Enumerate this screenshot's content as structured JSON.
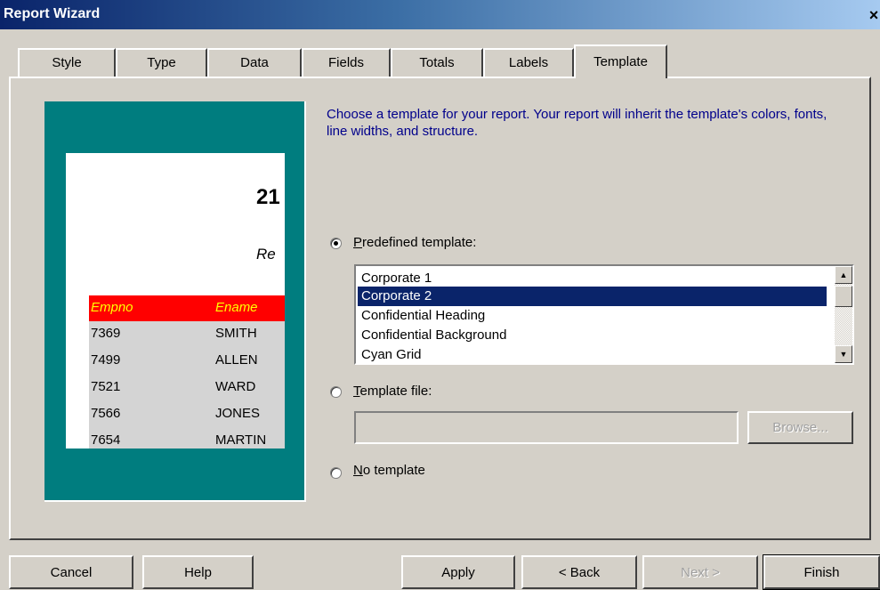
{
  "window": {
    "title": "Report Wizard",
    "close_glyph": "×"
  },
  "tabs": [
    {
      "label": "Style"
    },
    {
      "label": "Type"
    },
    {
      "label": "Data"
    },
    {
      "label": "Fields"
    },
    {
      "label": "Totals"
    },
    {
      "label": "Labels"
    },
    {
      "label": "Template",
      "active": true
    }
  ],
  "preview": {
    "title_fragment": "21",
    "subtitle_fragment": "Re",
    "columns": [
      "Empno",
      "Ename"
    ],
    "rows": [
      [
        "7369",
        "SMITH"
      ],
      [
        "7499",
        "ALLEN"
      ],
      [
        "7521",
        "WARD"
      ],
      [
        "7566",
        "JONES"
      ],
      [
        "7654",
        "MARTIN"
      ]
    ]
  },
  "instructions": "Choose a template for your report. Your report will inherit the template's colors, fonts, line widths, and structure.",
  "options": {
    "predefined": {
      "label": "Predefined template:",
      "mnemonic": "P",
      "rest": "redefined template:",
      "selected": true
    },
    "template_file": {
      "label": "Template file:",
      "mnemonic": "T",
      "rest": "emplate file:",
      "selected": false
    },
    "no_template": {
      "label": "No template",
      "mnemonic": "N",
      "rest": "o template",
      "selected": false
    }
  },
  "templates": {
    "items": [
      "Corporate 1",
      "Corporate 2",
      "Confidential Heading",
      "Confidential Background",
      "Cyan Grid"
    ],
    "selected": "Corporate 2"
  },
  "template_file": {
    "value": "",
    "browse_label": "Browse..."
  },
  "buttons": {
    "cancel": "Cancel",
    "help": "Help",
    "apply": "Apply",
    "back": "< Back",
    "next": "Next >",
    "finish": "Finish"
  },
  "colors": {
    "title_gradient_start": "#0a246a",
    "preview_bg": "#007d7f",
    "preview_header_bg": "#ff0000",
    "preview_header_text": "#ffff00",
    "instruction_text": "#00008b",
    "selection_bg": "#0a246a"
  }
}
